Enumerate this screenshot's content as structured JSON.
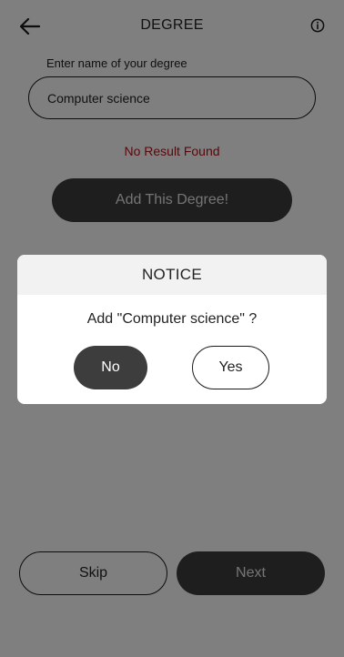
{
  "header": {
    "title": "DEGREE",
    "back_icon": "arrow-left-icon",
    "info_icon": "info-circle-icon"
  },
  "form": {
    "label": "Enter name of your degree",
    "input_value": "Computer science",
    "no_result_text": "No Result Found",
    "add_button_label": "Add This Degree!"
  },
  "footer": {
    "skip_label": "Skip",
    "next_label": "Next"
  },
  "dialog": {
    "title": "NOTICE",
    "message": "Add \"Computer science\" ?",
    "no_label": "No",
    "yes_label": "Yes"
  },
  "colors": {
    "dark_button": "#3d3d3d",
    "error_text": "#b3121a",
    "overlay": "rgba(0,0,0,0.5)",
    "dialog_header_bg": "#f2f2f2"
  }
}
